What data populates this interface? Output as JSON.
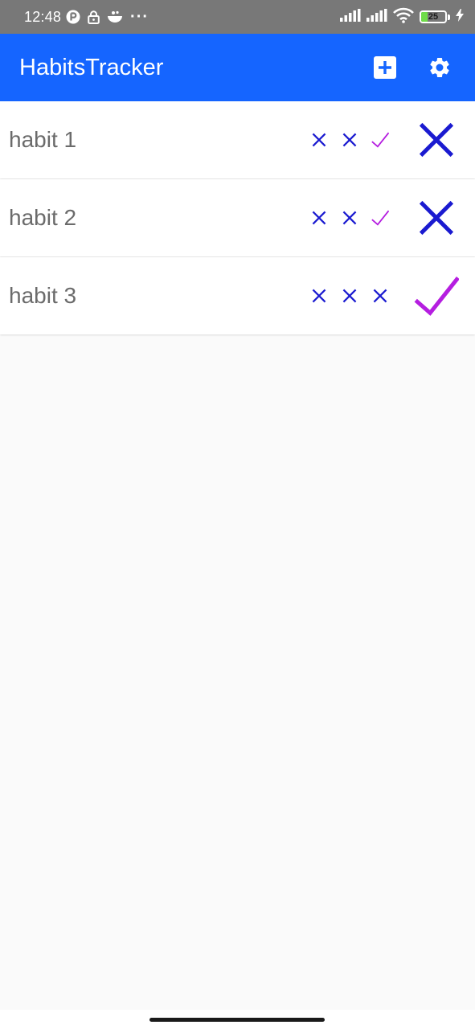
{
  "status_bar": {
    "time": "12:48",
    "dots": "···",
    "battery_level": "25",
    "battery_percent": 25
  },
  "app_bar": {
    "title": "HabitsTracker",
    "add_icon": "add-box-icon",
    "settings_icon": "gear-icon"
  },
  "habits": [
    {
      "name": "habit 1",
      "history": [
        "x",
        "x",
        "check"
      ],
      "today": "x"
    },
    {
      "name": "habit 2",
      "history": [
        "x",
        "x",
        "check"
      ],
      "today": "x"
    },
    {
      "name": "habit 3",
      "history": [
        "x",
        "x",
        "x"
      ],
      "today": "check"
    }
  ],
  "colors": {
    "app_bar": "#1565ff",
    "status_bar": "#787878",
    "cross": "#1a1ad0",
    "check": "#b51ee0",
    "background": "#fafafa"
  }
}
